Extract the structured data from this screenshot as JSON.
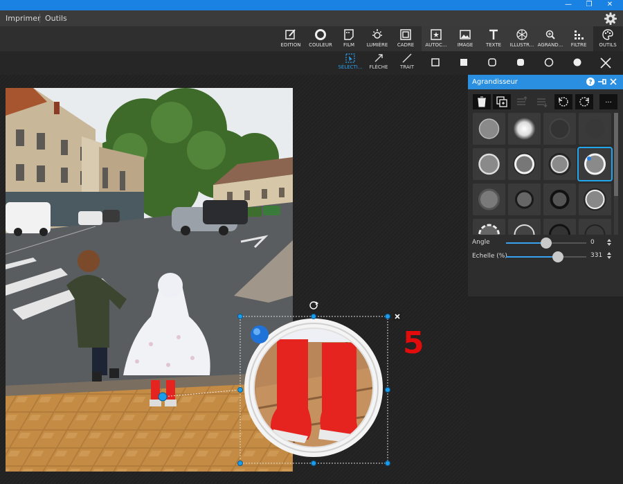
{
  "window": {
    "minimize": "—",
    "restore": "❐",
    "close": "✕"
  },
  "menu": [
    "Imprimer",
    "Outils"
  ],
  "toolbar": [
    {
      "label": "EDITION",
      "icon": "edit-icon"
    },
    {
      "label": "COULEUR",
      "icon": "color-ring-icon"
    },
    {
      "label": "FILM",
      "icon": "film-icon"
    },
    {
      "label": "LUMIÈRE",
      "icon": "sun-icon"
    },
    {
      "label": "CADRE",
      "icon": "frame-icon"
    },
    {
      "label": "AUTOC...",
      "icon": "sticker-icon"
    },
    {
      "label": "IMAGE",
      "icon": "image-icon"
    },
    {
      "label": "TEXTE",
      "icon": "text-icon"
    },
    {
      "label": "ILLUSTR...",
      "icon": "illustration-icon"
    },
    {
      "label": "AGRAND...",
      "icon": "magnifier-icon"
    },
    {
      "label": "FILTRE",
      "icon": "filter-icon"
    },
    {
      "label": "OUTILS",
      "icon": "palette-icon"
    }
  ],
  "subtools": [
    {
      "label": "SÉLECTI...",
      "icon": "selection-icon",
      "active": true
    },
    {
      "label": "FLÈCHE",
      "icon": "arrow-icon"
    },
    {
      "label": "TRAIT",
      "icon": "line-icon"
    }
  ],
  "shapes": [
    "square-outline-icon",
    "square-filled-icon",
    "rounded-square-outline-icon",
    "rounded-square-filled-icon",
    "circle-outline-icon",
    "circle-filled-icon"
  ],
  "panel": {
    "title": "Agrandisseur",
    "more_label": "...",
    "angle": {
      "label": "Angle",
      "value": "0",
      "fraction": 0.5
    },
    "scale": {
      "label": "Echelle (%)",
      "value": "331",
      "fraction": 0.65
    }
  },
  "annotation_number": "5",
  "colors": {
    "accent": "#2a8fe0",
    "badge": "#e30c0c"
  }
}
